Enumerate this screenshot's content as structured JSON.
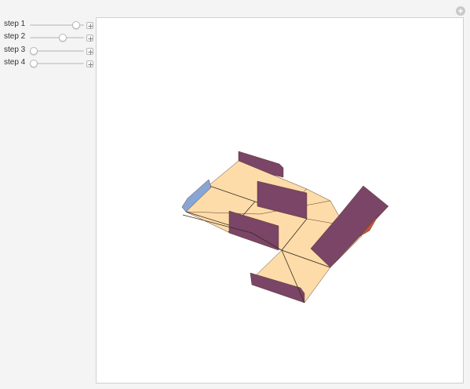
{
  "controls": [
    {
      "label": "step 1",
      "value": 0.92
    },
    {
      "label": "step 2",
      "value": 0.62
    },
    {
      "label": "step 3",
      "value": 0.0
    },
    {
      "label": "step 4",
      "value": 0.0
    }
  ],
  "colors": {
    "board_face": "#fddcaa",
    "flap_purple": "#7a4566",
    "flap_blue": "#87a6d6",
    "flap_orange": "#c4553a",
    "edge_line": "#3a2a20",
    "panel_background": "#ffffff"
  },
  "icons": {
    "corner": "plus-circle-icon",
    "control_step": "plus-box-icon"
  }
}
